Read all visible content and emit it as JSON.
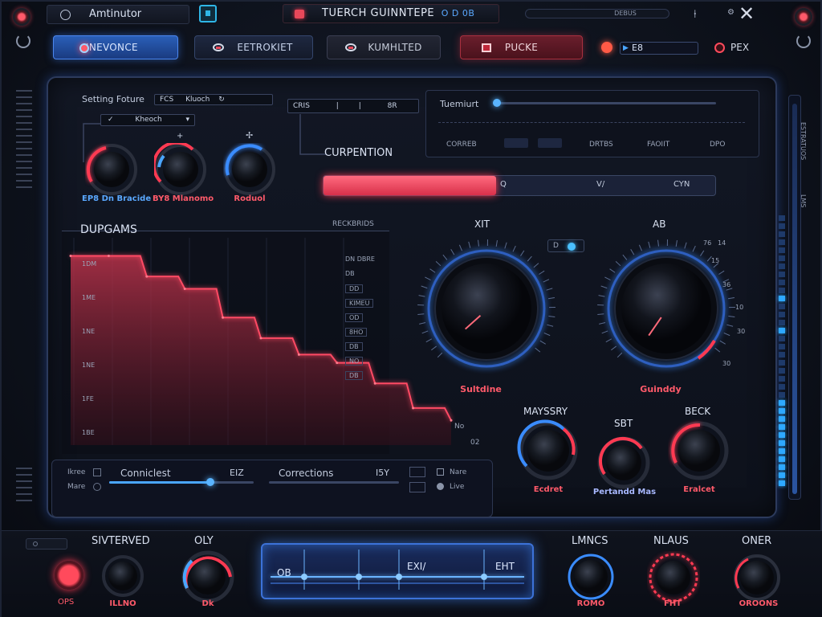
{
  "header": {
    "app_title": "Amtinutor",
    "center_title": "TUERCH GUINNTEPE",
    "center_badge": "O D 0B",
    "top_slider_label": "DEBUS",
    "close_glyph": "✕"
  },
  "tabs": [
    {
      "label": "INEVONCE"
    },
    {
      "label": "EETROKIET"
    },
    {
      "label": "KUMHLTED"
    },
    {
      "label": "PUCKE"
    }
  ],
  "transport": {
    "field_value": "E8",
    "pex_label": "PEX"
  },
  "setting": {
    "title": "Setting Foture",
    "field_a": "FCS",
    "field_b": "Kluoch",
    "dropdown_value": "Kheoch",
    "knobs": [
      {
        "label": "EP8 Dn Bracide"
      },
      {
        "label": "BY8 Mlanomo"
      },
      {
        "label": "Roduol"
      }
    ]
  },
  "curpention": {
    "segment_label": "CRIS",
    "segment_right": "8R",
    "title": "CURPENTION",
    "bar_fill_fraction": 0.44,
    "bar_labels": [
      "Q",
      "V/",
      "CYN"
    ]
  },
  "readout": {
    "title": "Tuemiurt",
    "columns": [
      "CORREB",
      "DRTBS",
      "FAOIIT",
      "DPO"
    ]
  },
  "dupgams": {
    "title": "DUPGAMS",
    "subtitle": "RECKBRIDS",
    "y_labels": [
      "1DM",
      "1ME",
      "1NE",
      "1NE",
      "1FE",
      "1BE"
    ],
    "right_labels": [
      "DN DBRE",
      "DB",
      "DD",
      "KIMEU",
      "OD",
      "8HO",
      "DB",
      "NO",
      "DB"
    ],
    "end_labels": [
      "No",
      "02"
    ]
  },
  "chart_data": {
    "type": "area",
    "title": "DUPGAMS",
    "x": [
      0,
      1,
      2,
      3,
      4,
      5,
      6,
      7,
      8,
      9,
      10
    ],
    "values": [
      92,
      92,
      82,
      76,
      62,
      52,
      44,
      40,
      30,
      18,
      12
    ],
    "ylim": [
      0,
      100
    ]
  },
  "big_knobs": [
    {
      "title": "XIT",
      "label": "Sultdine",
      "value": 0.22
    },
    {
      "title": "AB",
      "label": "Guinddy",
      "value": 0.15,
      "scale": [
        "76",
        "15",
        "36",
        "10",
        "30",
        "30",
        "14"
      ]
    }
  ],
  "toggle": {
    "label": "D"
  },
  "mid_knobs": [
    {
      "title": "MAYSSRY",
      "label": "Ecdret"
    },
    {
      "title": "SBT",
      "label": "Pertandd Mas"
    },
    {
      "title": "BECK",
      "label": "Eralcet"
    }
  ],
  "bottom_left_panel": {
    "left_labels": [
      "Ikree",
      "Mare"
    ],
    "slider1_label": "Conniclest",
    "slider1_value": "EIZ",
    "slider1_fraction": 0.7,
    "slider2_label": "Corrections",
    "slider2_value": "I5Y",
    "slider2_fraction": 0.0,
    "right_labels": [
      "Nare",
      "Live"
    ]
  },
  "right_side": {
    "vertical_text": "ESTRATUOS",
    "vertical_text2": "LMS"
  },
  "bottom": {
    "left_title": "SIVTERVED",
    "left_sublabel": "OPS",
    "left_knob_label": "ILLNO",
    "oly_title": "OLY",
    "oly_sublabel": "Dk",
    "display_labels": [
      "OB",
      "EXI/",
      "EHT"
    ],
    "right_knobs": [
      {
        "title": "LMNCS",
        "label": "ROMO"
      },
      {
        "title": "NLAUS",
        "label": "FHT"
      },
      {
        "title": "ONER",
        "label": "OROONS"
      }
    ]
  },
  "colors": {
    "accent_blue": "#4aa6ff",
    "accent_red": "#ff4a5c",
    "panel": "#121724"
  }
}
